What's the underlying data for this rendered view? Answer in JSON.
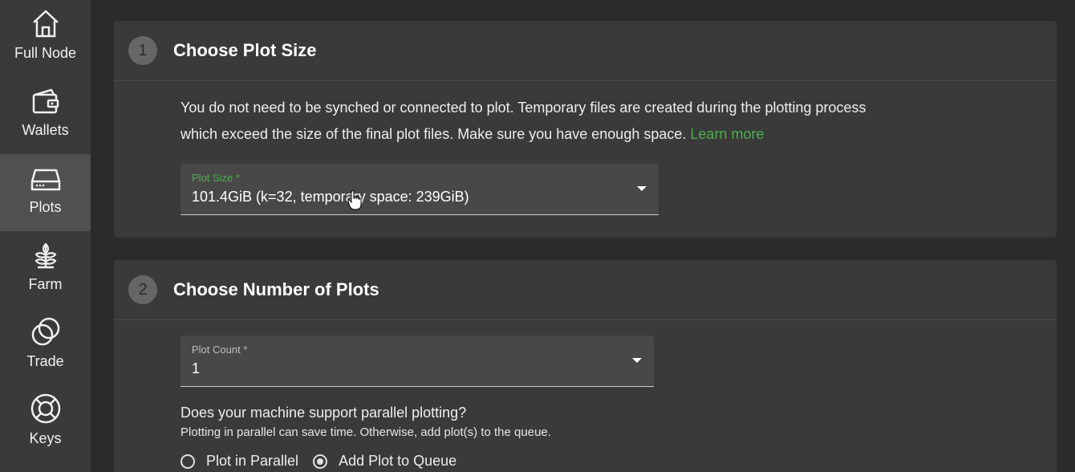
{
  "sidebar": {
    "items": [
      {
        "label": "Full Node",
        "icon": "home-icon",
        "active": false
      },
      {
        "label": "Wallets",
        "icon": "wallet-icon",
        "active": false
      },
      {
        "label": "Plots",
        "icon": "hard-drive-icon",
        "active": true
      },
      {
        "label": "Farm",
        "icon": "plant-icon",
        "active": false
      },
      {
        "label": "Trade",
        "icon": "trade-icon",
        "active": false
      },
      {
        "label": "Keys",
        "icon": "lifebuoy-icon",
        "active": false
      }
    ]
  },
  "step1": {
    "number": "1",
    "title": "Choose Plot Size",
    "description": "You do not need to be synched or connected to plot. Temporary files are created during the plotting process which exceed the size of the final plot files. Make sure you have enough space.",
    "learn_more": "Learn more",
    "plot_size": {
      "label": "Plot Size *",
      "value": "101.4GiB (k=32, temporary space: 239GiB)"
    }
  },
  "step2": {
    "number": "2",
    "title": "Choose Number of Plots",
    "plot_count": {
      "label": "Plot Count *",
      "value": "1"
    },
    "question": "Does your machine support parallel plotting?",
    "helper": "Plotting in parallel can save time. Otherwise, add plot(s) to the queue.",
    "options": [
      {
        "label": "Plot in Parallel",
        "selected": false
      },
      {
        "label": "Add Plot to Queue",
        "selected": true
      }
    ]
  },
  "colors": {
    "accent": "#4cae4c",
    "sidebar_bg": "#3a3a3a",
    "active_bg": "#505050",
    "card_bg": "#3a3a3a",
    "page_bg": "#2b2b2b"
  }
}
